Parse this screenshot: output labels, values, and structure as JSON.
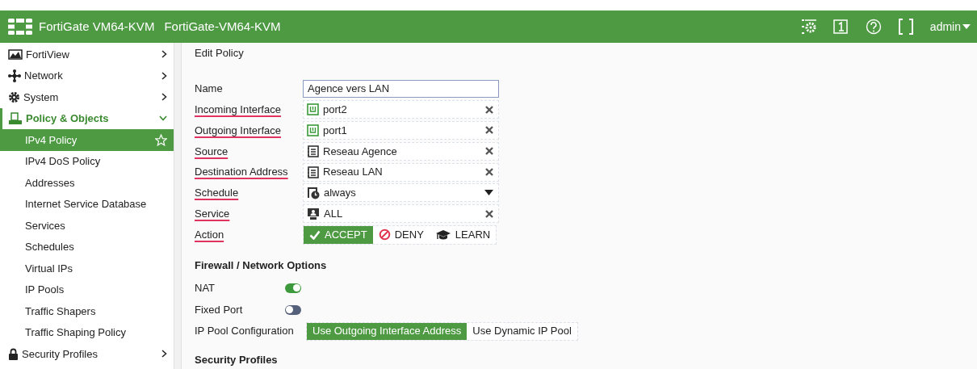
{
  "header": {
    "product": "FortiGate VM64-KVM",
    "hostname": "FortiGate-VM64-KVM",
    "user": "admin"
  },
  "sidebar": {
    "items": [
      {
        "label": "FortiView",
        "kind": "section",
        "expanded": false,
        "selected": false
      },
      {
        "label": "Network",
        "kind": "section",
        "expanded": false,
        "selected": false
      },
      {
        "label": "System",
        "kind": "section",
        "expanded": false,
        "selected": false
      },
      {
        "label": "Policy & Objects",
        "kind": "section",
        "expanded": true,
        "selected": false
      },
      {
        "label": "IPv4 Policy",
        "kind": "sub",
        "selected": true
      },
      {
        "label": "IPv4 DoS Policy",
        "kind": "sub",
        "selected": false
      },
      {
        "label": "Addresses",
        "kind": "sub",
        "selected": false
      },
      {
        "label": "Internet Service Database",
        "kind": "sub",
        "selected": false
      },
      {
        "label": "Services",
        "kind": "sub",
        "selected": false
      },
      {
        "label": "Schedules",
        "kind": "sub",
        "selected": false
      },
      {
        "label": "Virtual IPs",
        "kind": "sub",
        "selected": false
      },
      {
        "label": "IP Pools",
        "kind": "sub",
        "selected": false
      },
      {
        "label": "Traffic Shapers",
        "kind": "sub",
        "selected": false
      },
      {
        "label": "Traffic Shaping Policy",
        "kind": "sub",
        "selected": false
      },
      {
        "label": "Security Profiles",
        "kind": "section",
        "expanded": false,
        "selected": false
      }
    ]
  },
  "page_title": "Edit Policy",
  "fields": [
    {
      "label": "Name",
      "flagged": false,
      "kind": "text",
      "value": "Agence vers LAN"
    },
    {
      "label": "Incoming Interface",
      "flagged": true,
      "kind": "interface",
      "value": "port2"
    },
    {
      "label": "Outgoing Interface",
      "flagged": true,
      "kind": "interface",
      "value": "port1"
    },
    {
      "label": "Source",
      "flagged": true,
      "kind": "address",
      "value": "Reseau Agence"
    },
    {
      "label": "Destination Address",
      "flagged": true,
      "kind": "address",
      "value": "Reseau LAN"
    },
    {
      "label": "Schedule",
      "flagged": true,
      "kind": "schedule",
      "value": "always"
    },
    {
      "label": "Service",
      "flagged": true,
      "kind": "service",
      "value": "ALL"
    }
  ],
  "action": {
    "label": "Action",
    "flagged": true,
    "options": [
      {
        "label": "ACCEPT",
        "selected": true
      },
      {
        "label": "DENY",
        "selected": false
      },
      {
        "label": "LEARN",
        "selected": false
      }
    ]
  },
  "firewall_options": {
    "title": "Firewall / Network Options",
    "toggles": [
      {
        "label": "NAT",
        "on": true
      },
      {
        "label": "Fixed Port",
        "on": false
      }
    ],
    "ip_pool": {
      "label": "IP Pool Configuration",
      "options": [
        {
          "label": "Use Outgoing Interface Address",
          "selected": true
        },
        {
          "label": "Use Dynamic IP Pool",
          "selected": false
        }
      ]
    }
  },
  "next_section": "Security Profiles"
}
